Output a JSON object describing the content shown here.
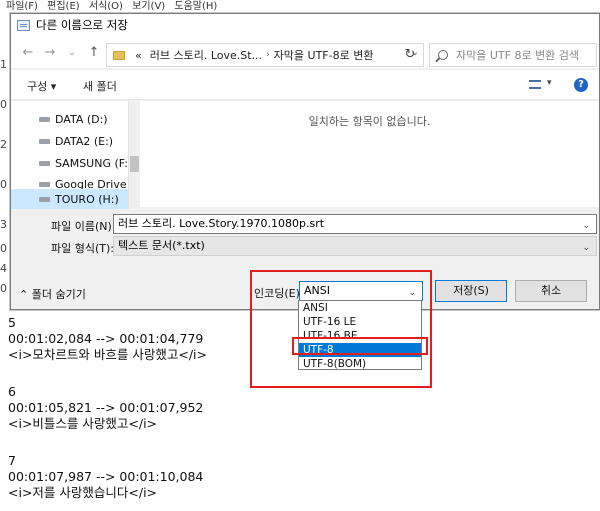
{
  "notepad": {
    "menu": [
      "파일(F)",
      "편집(E)",
      "서식(O)",
      "보기(V)",
      "도움말(H)"
    ],
    "edge_chars": [
      "1",
      "0",
      "2",
      "0",
      "3",
      "0",
      "4",
      "0"
    ],
    "lines": [
      {
        "text": "5"
      },
      {
        "text": "00:01:02,084 --> 00:01:04,779"
      },
      {
        "text": "<i>모차르트와 바흐를 사랑했고</i>"
      },
      {
        "text": "6"
      },
      {
        "text": "00:01:05,821 --> 00:01:07,952"
      },
      {
        "text": "<i>비틀스를 사랑했고</i>"
      },
      {
        "text": "7"
      },
      {
        "text": "00:01:07,987 --> 00:01:10,084"
      },
      {
        "text": "<i>저를 사랑했습니다</i>"
      }
    ]
  },
  "dialog": {
    "title": "다른 이름으로 저장",
    "nav": {
      "back": "←",
      "forward": "→",
      "recent": "⌄",
      "up": "↑"
    },
    "address": {
      "prefix": "«",
      "seg1": "러브 스토리. Love.St...",
      "sep": "›",
      "seg2": "자막을 UTF-8로 변환",
      "drop": "⌄"
    },
    "refresh": "↻",
    "search_placeholder": "자막을 UTF 8로 변환 검색",
    "toolbar": {
      "organize": "구성 ▾",
      "new_folder": "새 폴더",
      "view_drop": "▾",
      "help": "?"
    },
    "nav_items": [
      {
        "label": "DATA (D:)"
      },
      {
        "label": "DATA2 (E:)"
      },
      {
        "label": "SAMSUNG (F:)"
      },
      {
        "label": "Google Drive (G"
      },
      {
        "label": "TOURO (H:)"
      }
    ],
    "empty_message": "일치하는 항목이 없습니다.",
    "file_name_label": "파일 이름(N):",
    "file_name_value": "러브 스토리. Love.Story.1970.1080p.srt",
    "file_type_label": "파일 형식(T):",
    "file_type_value": "텍스트 문서(*.txt)",
    "dropdown_caret": "⌄",
    "hide_folders": "⌃ 폴더 숨기기",
    "encoding_label": "인코딩(E):",
    "encoding_value": "ANSI",
    "encoding_options": [
      {
        "label": "ANSI"
      },
      {
        "label": "UTF-16 LE"
      },
      {
        "label": "UTF-16 BE"
      },
      {
        "label": "UTF-8"
      },
      {
        "label": "UTF-8(BOM)"
      }
    ],
    "encoding_selected": "UTF-8",
    "save_button": "저장(S)",
    "cancel_button": "취소"
  },
  "colors": {
    "highlight": "#0078d7",
    "annotation": "#e11d1d",
    "selected_item": "#cce8ff"
  }
}
